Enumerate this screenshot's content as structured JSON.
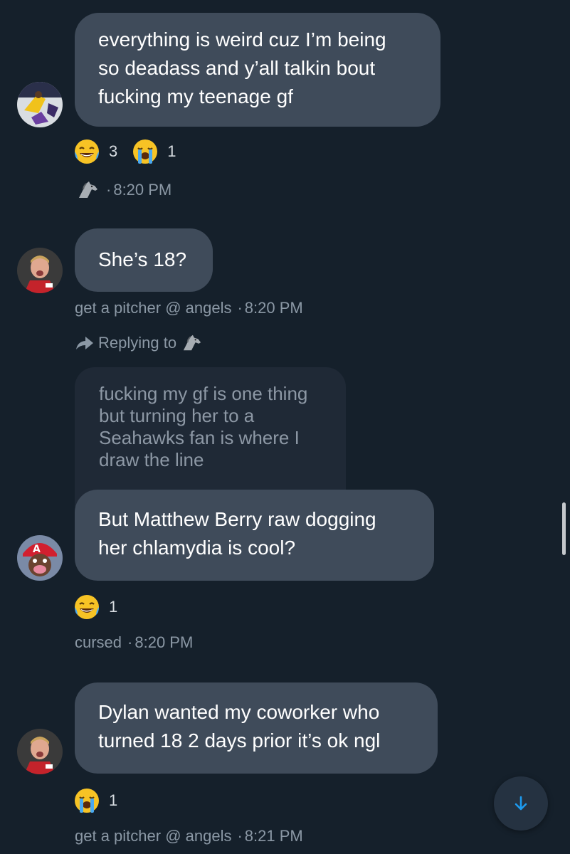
{
  "messages": [
    {
      "lines": [
        "everything is weird cuz I’m being",
        "so deadass and y’all talkin bout",
        "fucking my teenage gf"
      ],
      "reactions": [
        {
          "emoji": "face-with-tears-of-joy",
          "count": "3"
        },
        {
          "emoji": "loudly-crying-face",
          "count": "1"
        }
      ],
      "sender": "",
      "sender_icon": "horse-icon",
      "time": "8:20 PM"
    },
    {
      "lines": [
        "She’s 18?"
      ],
      "sender": "get a pitcher @ angels",
      "time": "8:20 PM"
    },
    {
      "replying_to_label": "Replying to",
      "replying_to_icon": "horse-icon",
      "quoted_lines": [
        "fucking my gf is one thing",
        "but turning her to a",
        "Seahawks fan is where I",
        "draw the line"
      ],
      "lines": [
        "But Matthew Berry raw dogging",
        "her chlamydia is cool?"
      ],
      "reactions": [
        {
          "emoji": "face-with-tears-of-joy",
          "count": "1"
        }
      ],
      "sender": "cursed",
      "time": "8:20 PM"
    },
    {
      "lines": [
        "Dylan wanted my coworker who",
        "turned 18 2 days prior it’s ok ngl"
      ],
      "reactions": [
        {
          "emoji": "loudly-crying-face",
          "count": "1"
        }
      ],
      "sender": "get a pitcher @ angels",
      "time": "8:21 PM"
    }
  ],
  "separator": "·",
  "colors": {
    "background": "#15202b",
    "bubble": "#3f4b5a",
    "quoted_bubble": "#1f2936",
    "meta_text": "#8b98a5",
    "accent": "#1d9bf0"
  },
  "scroll_down_icon": "arrow-down-icon"
}
